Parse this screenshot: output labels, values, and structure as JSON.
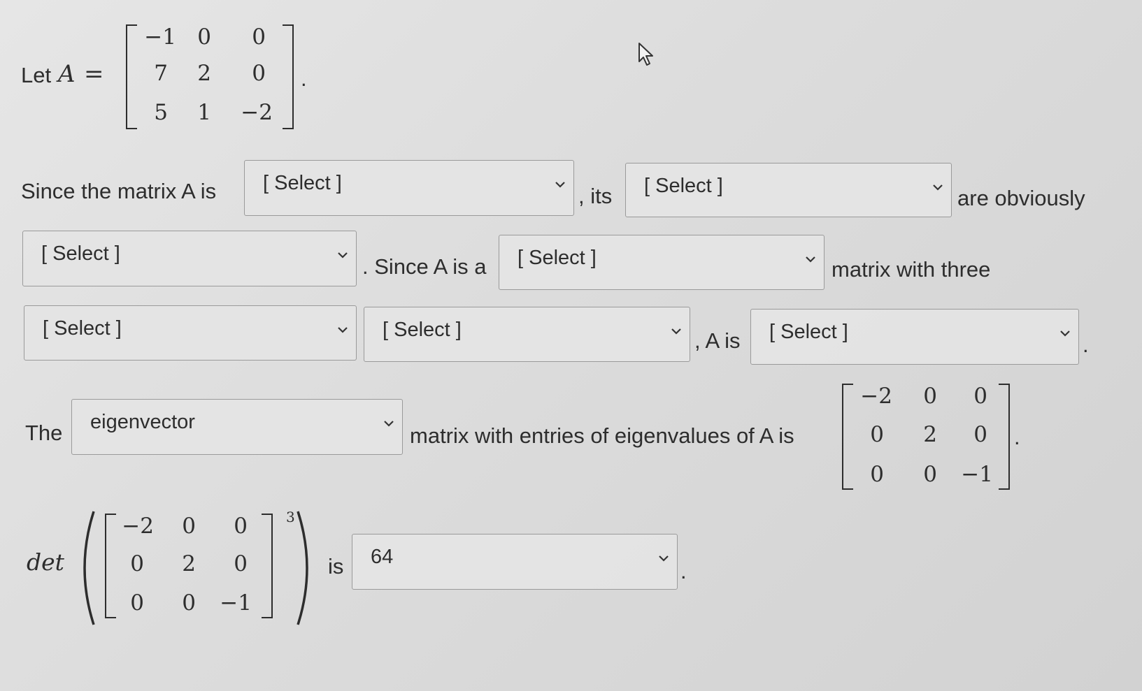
{
  "problem": {
    "let_prefix": "Let",
    "let_var": "A",
    "let_eq": "=",
    "matrix_a": [
      [
        "−1",
        "0",
        "0"
      ],
      [
        "7",
        "2",
        "0"
      ],
      [
        "5",
        "1",
        "−2"
      ]
    ],
    "period": ".",
    "line2_text1": "Since the matrix A is",
    "line2_text2": ", its",
    "line2_text3": "are obviously",
    "line3_text1": ". Since A is a",
    "line3_text2": "matrix with three",
    "line4_text1": ", A is",
    "line4_text2": ".",
    "line5_text1": "The",
    "line5_text2": "matrix with entries of eigenvalues of A is",
    "matrix_d": [
      [
        "−2",
        "0",
        "0"
      ],
      [
        "0",
        "2",
        "0"
      ],
      [
        "0",
        "0",
        "−1"
      ]
    ],
    "det_label": "det",
    "det_exponent": "3",
    "det_is": "is"
  },
  "dropdowns": {
    "d1": "[ Select ]",
    "d2": "[ Select ]",
    "d3": "[ Select ]",
    "d4": "[ Select ]",
    "d5": "[ Select ]",
    "d6": "[ Select ]",
    "d7": "[ Select ]",
    "d8": "eigenvector",
    "d9": "64"
  },
  "icons": [
    "chevron-down-icon",
    "mouse-pointer-icon"
  ]
}
